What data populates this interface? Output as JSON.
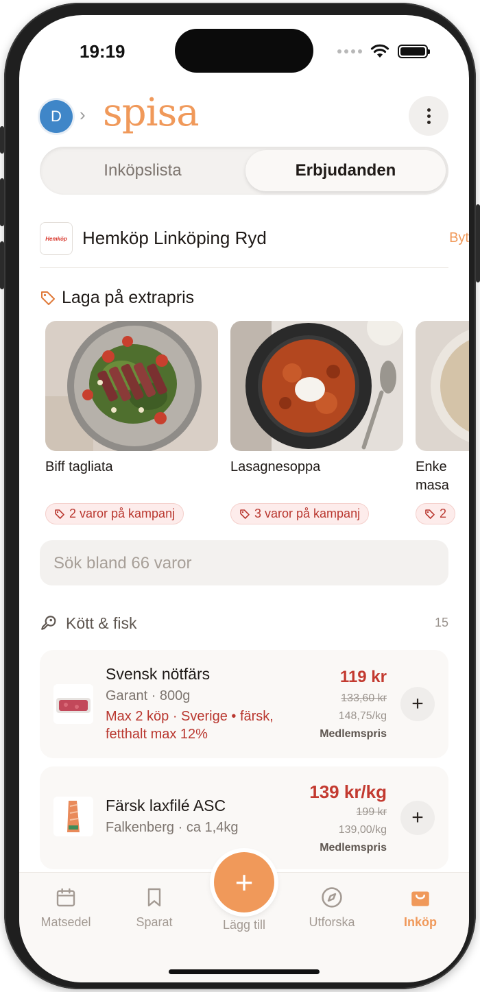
{
  "status_bar": {
    "time": "19:19"
  },
  "header": {
    "avatar_initial": "D",
    "app_name": "spisa"
  },
  "segment": {
    "tab_left": "Inköpslista",
    "tab_right": "Erbjudanden",
    "active": "Erbjudanden"
  },
  "store": {
    "logo_text": "Hemköp",
    "name": "Hemköp Linköping Ryd",
    "change_label": "Byt"
  },
  "section": {
    "title": "Laga på extrapris"
  },
  "recipes": [
    {
      "title": "Biff tagliata",
      "badge": "2 varor på kampanj"
    },
    {
      "title": "Lasagnesoppa",
      "badge": "3 varor på kampanj"
    },
    {
      "title": "Enke\nmasa",
      "badge": "2"
    }
  ],
  "search": {
    "placeholder": "Sök bland 66 varor"
  },
  "category": {
    "label": "Kött & fisk",
    "count": "15"
  },
  "products": [
    {
      "name": "Svensk nötfärs",
      "sub": "Garant · 800g",
      "note": "Max 2 köp · Sverige • färsk, fetthalt max 12%",
      "price": "119 kr",
      "old_price": "133,60 kr",
      "unit_price": "148,75/kg",
      "member": "Medlemspris"
    },
    {
      "name": "Färsk laxfilé ASC",
      "sub": "Falkenberg · ca 1,4kg",
      "note": "",
      "price": "139 kr/kg",
      "old_price": "199 kr",
      "unit_price": "139,00/kg",
      "member": "Medlemspris"
    }
  ],
  "tabbar": {
    "items": [
      {
        "label": "Matsedel",
        "icon": "calendar-icon"
      },
      {
        "label": "Sparat",
        "icon": "bookmark-icon"
      },
      {
        "label": "Lägg till",
        "icon": "plus-icon"
      },
      {
        "label": "Utforska",
        "icon": "compass-icon"
      },
      {
        "label": "Inköp",
        "icon": "shopping-bag-icon"
      }
    ],
    "active": "Inköp"
  },
  "colors": {
    "accent": "#f0995a",
    "sale_red": "#c33a30",
    "avatar_blue": "#3f86c8"
  }
}
